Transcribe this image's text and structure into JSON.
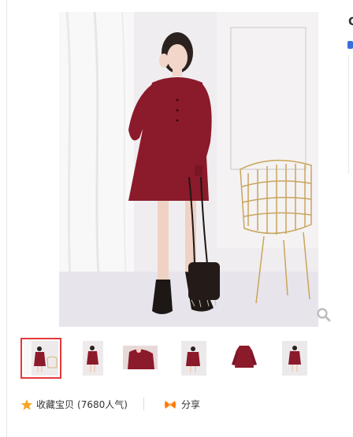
{
  "product": {
    "main_image_alt": "",
    "thumbnails": [
      {
        "selected": true
      },
      {
        "selected": false
      },
      {
        "selected": false
      },
      {
        "selected": false
      },
      {
        "selected": false
      },
      {
        "selected": false
      }
    ]
  },
  "actions": {
    "favorite_label": "收藏宝贝",
    "favorite_count": "(7680人气)",
    "share_label": "分享"
  },
  "icons": {
    "favorite": "star-icon",
    "share": "share-icon",
    "zoom": "magnifier-icon"
  },
  "colors": {
    "accent_border": "#e4393c",
    "star": "#f5a623",
    "share": "#ff7a00",
    "dress": "#8b1a2b"
  },
  "right_panel": {
    "glyph": "C"
  }
}
